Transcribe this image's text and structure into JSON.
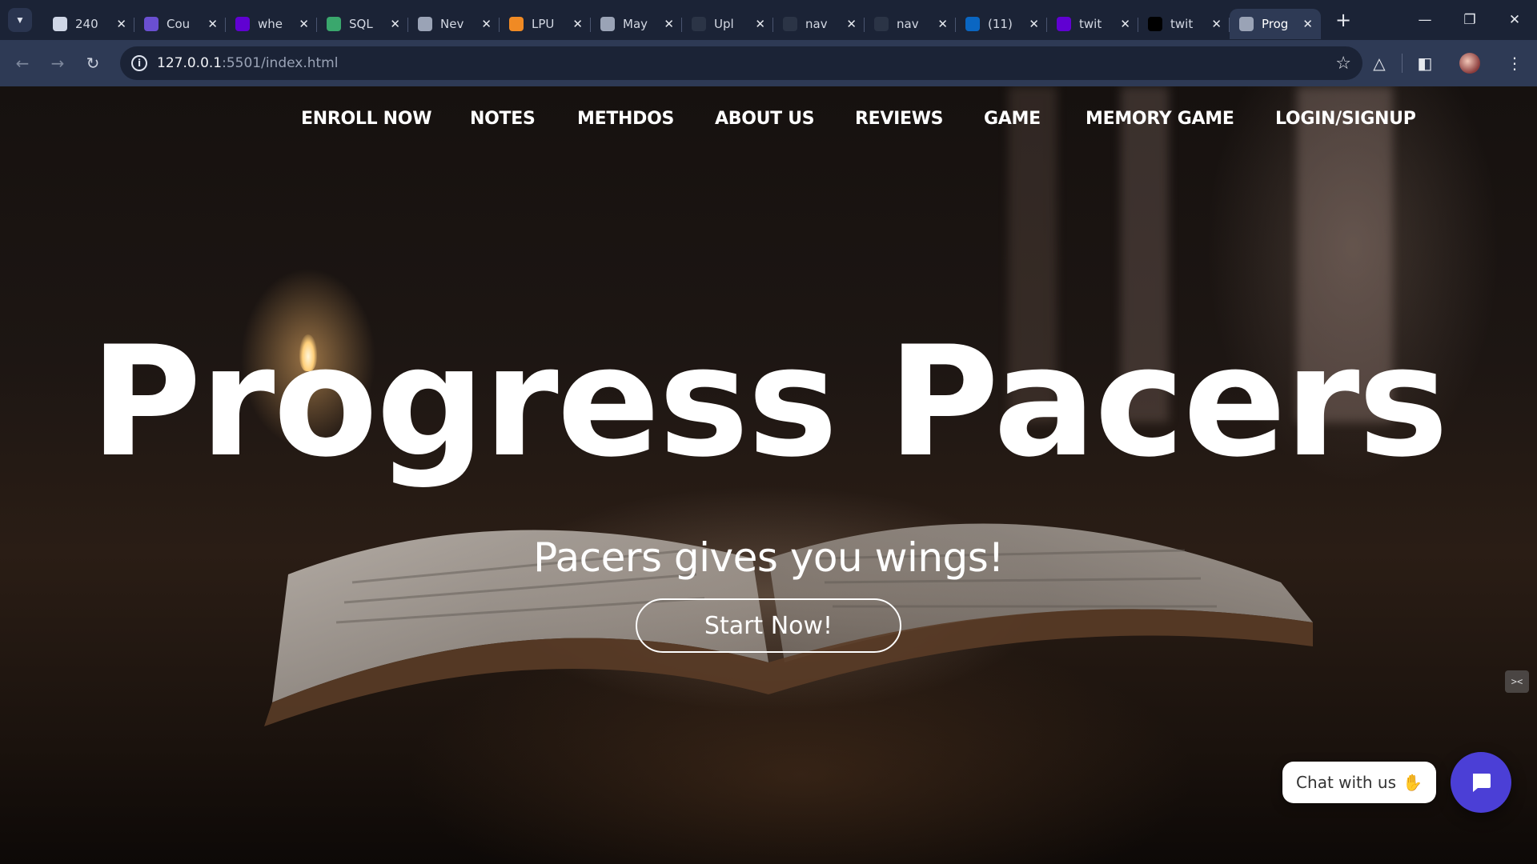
{
  "browser": {
    "tabs": [
      {
        "title": "240",
        "favicon": "cloud-icon",
        "color": "#cfd6e6"
      },
      {
        "title": "Cou",
        "favicon": "coursera-icon",
        "color": "#6a4fd1"
      },
      {
        "title": "whe",
        "favicon": "yahoo-icon",
        "color": "#6001d2"
      },
      {
        "title": "SQL",
        "favicon": "sql-icon",
        "color": "#3aa76d"
      },
      {
        "title": "Nev",
        "favicon": "globe-icon",
        "color": "#9aa3b6"
      },
      {
        "title": "LPU",
        "favicon": "lpu-icon",
        "color": "#f08a24"
      },
      {
        "title": "May",
        "favicon": "globe-icon",
        "color": "#9aa3b6"
      },
      {
        "title": "Upl",
        "favicon": "github-icon",
        "color": "#2b3446"
      },
      {
        "title": "nav",
        "favicon": "github-icon",
        "color": "#2b3446"
      },
      {
        "title": "nav",
        "favicon": "github-icon",
        "color": "#2b3446"
      },
      {
        "title": "(11)",
        "favicon": "linkedin-icon",
        "color": "#0a66c2"
      },
      {
        "title": "twit",
        "favicon": "yahoo-icon",
        "color": "#6001d2"
      },
      {
        "title": "twit",
        "favicon": "x-icon",
        "color": "#000000"
      },
      {
        "title": "Prog",
        "favicon": "globe-icon",
        "color": "#9aa3b6",
        "active": true
      }
    ],
    "url_host": "127.0.0.1",
    "url_rest": ":5501/index.html"
  },
  "nav": {
    "items": [
      "ENROLL NOW",
      "NOTES",
      "METHDOS",
      "ABOUT US",
      "REVIEWS",
      "GAME",
      "MEMORY GAME",
      "LOGIN/SIGNUP"
    ]
  },
  "hero": {
    "title": "Progress Pacers",
    "subtitle": "Pacers gives you wings!",
    "cta": "Start Now!"
  },
  "chat": {
    "label": "Chat with us",
    "accent": "#4b3fd6"
  },
  "colors": {
    "chrome_dark": "#1b2336",
    "chrome_toolbar": "#2e3a55"
  }
}
